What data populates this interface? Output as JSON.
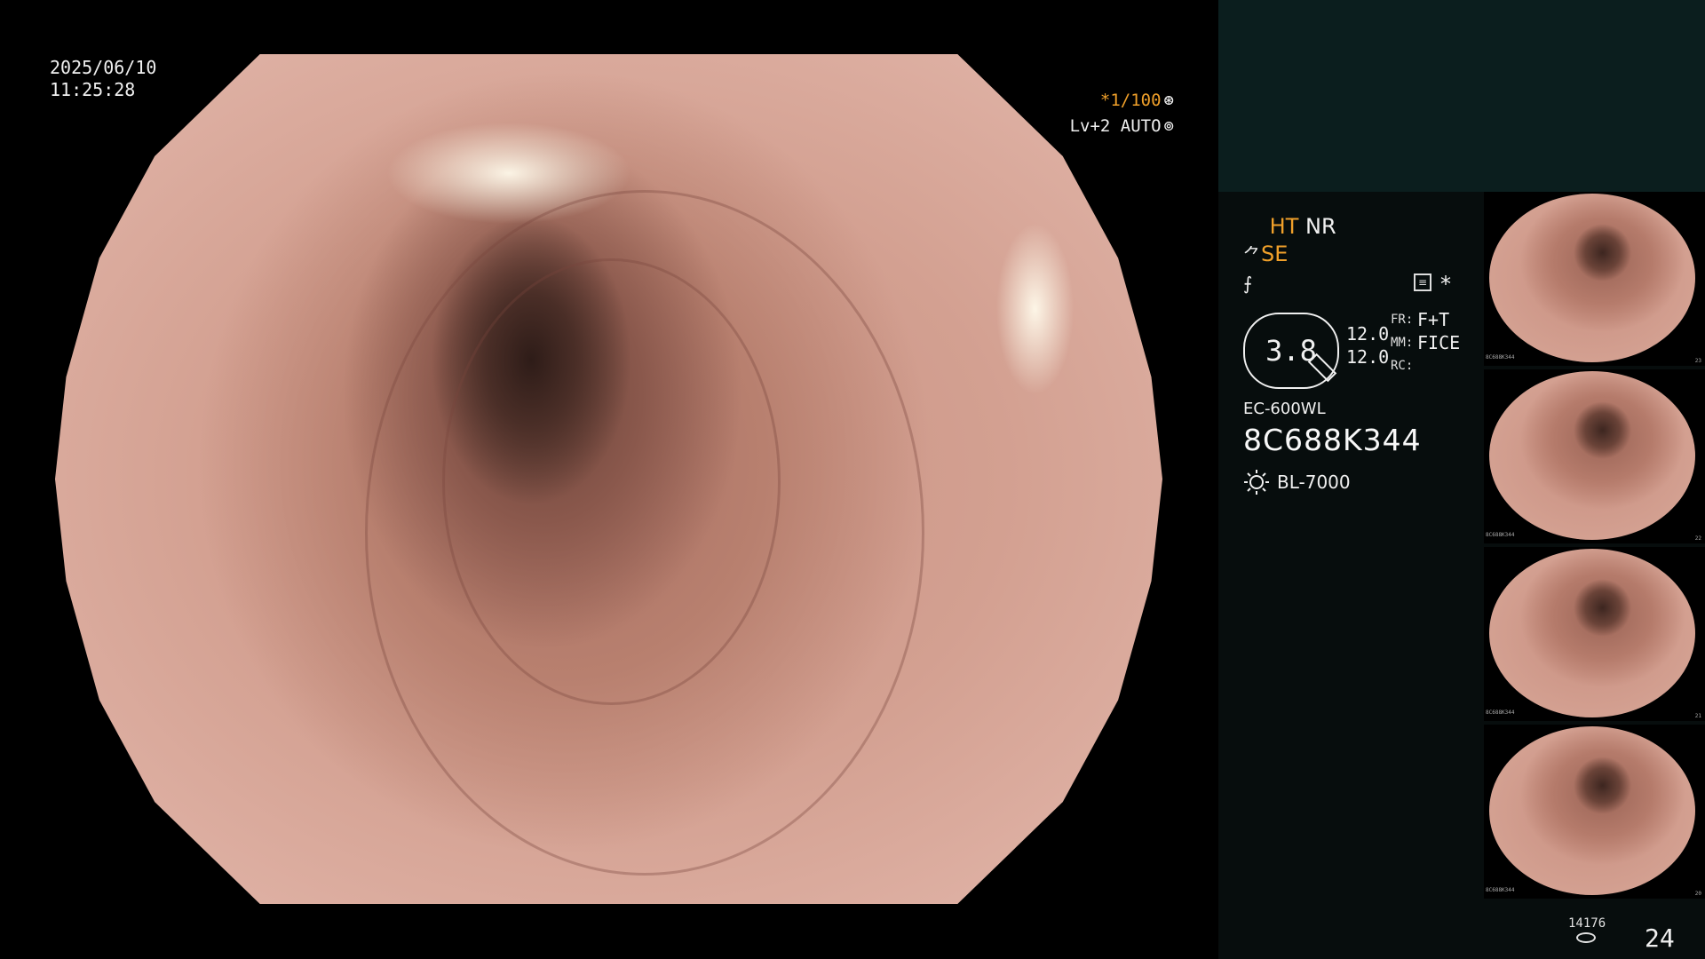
{
  "osd": {
    "date": "2025/06/10",
    "time": "11:25:28",
    "shutter": "*1/100",
    "shutter_icon": "aperture-icon",
    "level": "Lv+2 AUTO",
    "level_icon": "iris-icon"
  },
  "panel": {
    "ht_label": "HT",
    "nr_label": "NR",
    "se_label": "SE",
    "zoom": "3.8",
    "param1": "12.0",
    "param2": "12.0",
    "fr_label": "FR:",
    "mm_label": "MM:",
    "rc_label": "RC:",
    "fr_value": "F+T",
    "mm_value": "FICE",
    "scope_model": "EC-600WL",
    "serial": "8C688K344",
    "light_source": "BL-7000",
    "counter_small": "14176",
    "counter_big": "24"
  },
  "thumbnails": [
    {
      "index": "23"
    },
    {
      "index": "22"
    },
    {
      "index": "21"
    },
    {
      "index": "20"
    }
  ],
  "colors": {
    "accent": "#f0a02a",
    "panel_top": "#0b1e1e",
    "panel_bg": "#070d0d"
  }
}
